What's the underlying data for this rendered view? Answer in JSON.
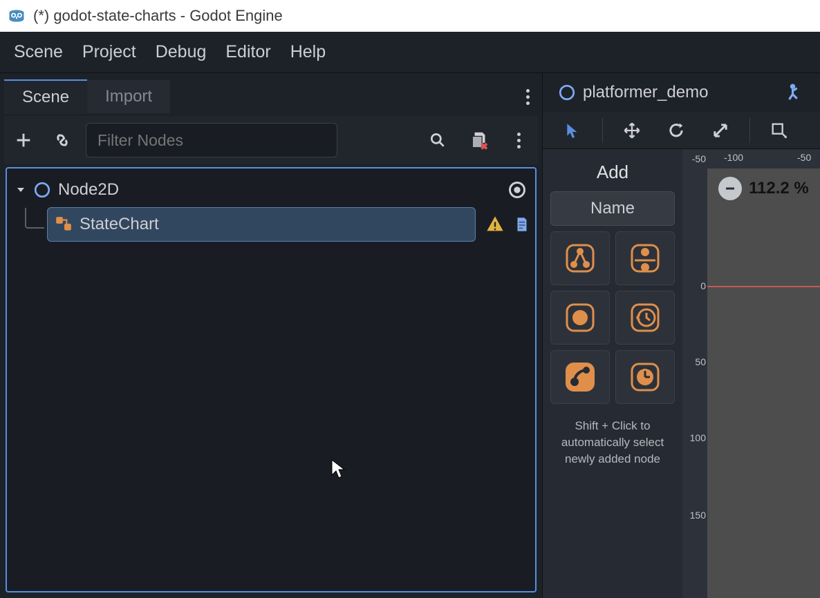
{
  "window": {
    "title": "(*) godot-state-charts - Godot Engine"
  },
  "menubar": {
    "items": [
      "Scene",
      "Project",
      "Debug",
      "Editor",
      "Help"
    ]
  },
  "left_panel": {
    "tabs": {
      "scene": "Scene",
      "import": "Import"
    },
    "filter_placeholder": "Filter Nodes",
    "tree": {
      "root": {
        "name": "Node2D"
      },
      "child": {
        "name": "StateChart"
      }
    }
  },
  "right_panel": {
    "scene_title": "platformer_demo",
    "add_panel": {
      "title": "Add",
      "header": "Name",
      "hint": "Shift + Click to automatically select newly added node"
    },
    "ruler_h": {
      "ticks": [
        "-100",
        "-50"
      ]
    },
    "ruler_v": {
      "ticks": [
        "-50",
        "0",
        "50",
        "100",
        "150"
      ]
    },
    "zoom": "112.2 %"
  },
  "colors": {
    "accent": "#5a8ee0",
    "orange": "#e08f4b",
    "bg_dark": "#1d2229",
    "bg_panel": "#21262d",
    "bg_input": "#191d23"
  }
}
